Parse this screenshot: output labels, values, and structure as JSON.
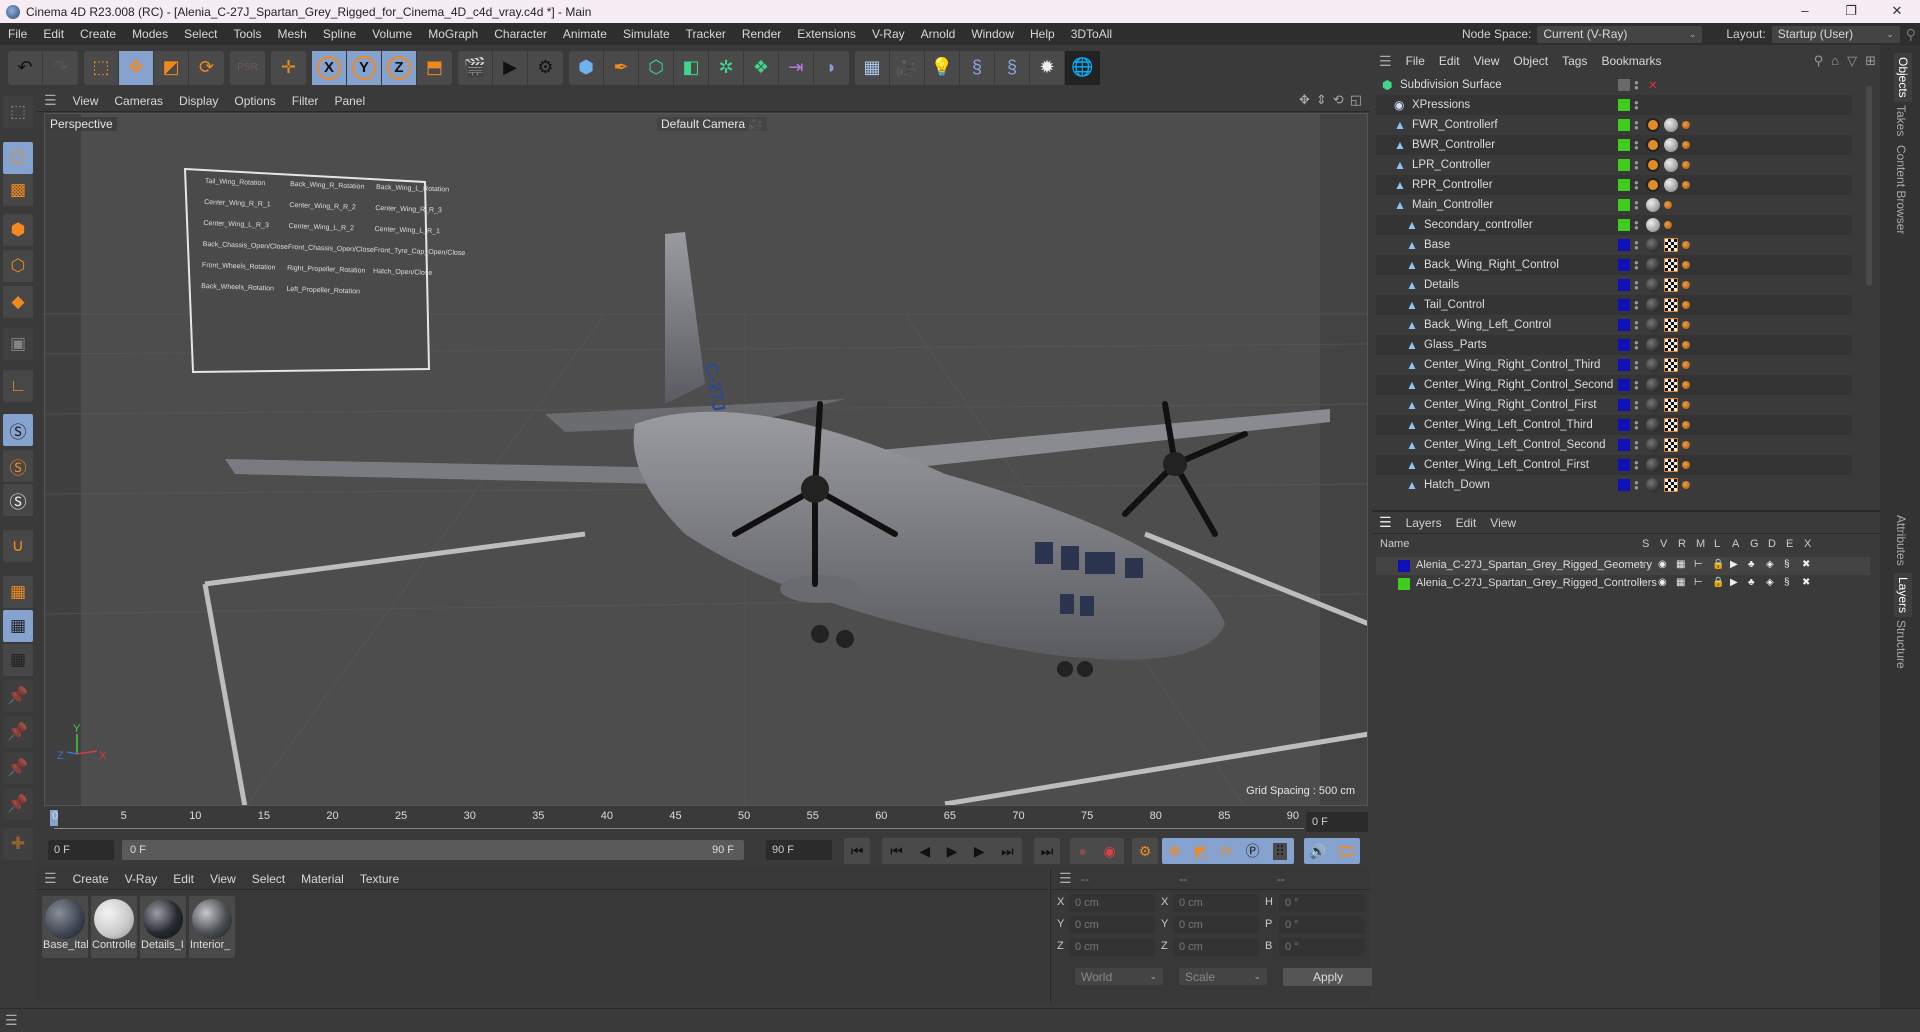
{
  "window": {
    "title": "Cinema 4D R23.008 (RC) - [Alenia_C-27J_Spartan_Grey_Rigged_for_Cinema_4D_c4d_vray.c4d *] - Main",
    "controls": {
      "minimize": "–",
      "maximize": "❐",
      "close": "✕"
    }
  },
  "menubar": {
    "items": [
      "File",
      "Edit",
      "Create",
      "Modes",
      "Select",
      "Tools",
      "Mesh",
      "Spline",
      "Volume",
      "MoGraph",
      "Character",
      "Animate",
      "Simulate",
      "Tracker",
      "Render",
      "Extensions",
      "V-Ray",
      "Arnold",
      "Window",
      "Help",
      "3DToAll"
    ],
    "node_space_label": "Node Space:",
    "node_space_value": "Current (V-Ray)",
    "layout_label": "Layout:",
    "layout_value": "Startup (User)"
  },
  "toolbar": {
    "groups": [
      [
        "undo-icon",
        "redo-icon"
      ],
      [
        "live-selection-icon",
        "move-icon",
        "scale-icon",
        "rotate-icon"
      ],
      [
        "psr-icon"
      ],
      [
        "axis-move-icon"
      ],
      [
        "x-axis-lock-icon",
        "y-axis-lock-icon",
        "z-axis-lock-icon",
        "coordinate-system-icon"
      ],
      [
        "render-view-icon",
        "render-to-picture-viewer-icon",
        "render-settings-icon"
      ],
      [
        "cube-icon",
        "pen-icon",
        "subdivision-icon",
        "extrude-icon",
        "mograph-cloner-icon",
        "array-icon",
        "symmetry-icon",
        "deformer-icon"
      ],
      [
        "floor-icon",
        "camera-icon",
        "light-icon",
        "python-icon",
        "python-generator-icon",
        "xpresso-icon",
        "sphere-wireframe-icon"
      ]
    ]
  },
  "viewport": {
    "menu": [
      "View",
      "Cameras",
      "Display",
      "Options",
      "Filter",
      "Panel"
    ],
    "view_name": "Perspective",
    "camera": "Default Camera",
    "grid_spacing": "Grid Spacing : 500 cm",
    "axis": {
      "x": "X",
      "y": "Y",
      "z": "Z"
    },
    "hud_panel": {
      "labels": [
        "Tail_Wing_Rotation",
        "Back_Wing_R_Rotation",
        "Back_Wing_L_Rotation",
        "Center_Wing_R_R_1",
        "Center_Wing_R_R_2",
        "Center_Wing_R_R_3",
        "Center_Wing_L_R_3",
        "Center_Wing_L_R_2",
        "Center_Wing_L_R_1",
        "Back_Chassis_Open/Close",
        "Front_Chassis_Open/Close",
        "Front_Tyre_Cap_Open/Close",
        "Front_Wheels_Rotation",
        "Right_Propeller_Rotation",
        "Hatch_Open/Close",
        "Back_Wheels_Rotation",
        "Left_Propeller_Rotation"
      ]
    },
    "aircraft_marking": "C-27J"
  },
  "timeline": {
    "ticks": [
      "0",
      "5",
      "10",
      "15",
      "20",
      "25",
      "30",
      "35",
      "40",
      "45",
      "50",
      "55",
      "60",
      "65",
      "70",
      "75",
      "80",
      "85",
      "90"
    ],
    "current_frame": "0 F",
    "start_field": "0 F",
    "range_start": "0 F",
    "range_end": "90 F",
    "end_field": "90 F"
  },
  "material_panel": {
    "menu": [
      "Create",
      "V-Ray",
      "Edit",
      "View",
      "Select",
      "Material",
      "Texture"
    ],
    "materials": [
      {
        "name": "Base_Ital",
        "color": "#3c4350"
      },
      {
        "name": "Controlle",
        "color": "#d6d6d6"
      },
      {
        "name": "Details_I",
        "color": "#262a30"
      },
      {
        "name": "Interior_",
        "color": "#4a4d52"
      }
    ]
  },
  "coord_panel": {
    "header": [
      "--",
      "--",
      "--"
    ],
    "rows": [
      {
        "a_label": "X",
        "a": "0 cm",
        "b_label": "X",
        "b": "0 cm",
        "c_label": "H",
        "c": "0 °"
      },
      {
        "a_label": "Y",
        "a": "0 cm",
        "b_label": "Y",
        "b": "0 cm",
        "c_label": "P",
        "c": "0 °"
      },
      {
        "a_label": "Z",
        "a": "0 cm",
        "b_label": "Z",
        "b": "0 cm",
        "c_label": "B",
        "c": "0 °"
      }
    ],
    "mode_dropdown": "World",
    "type_dropdown": "Scale",
    "apply_label": "Apply"
  },
  "object_manager": {
    "menu": [
      "File",
      "Edit",
      "View",
      "Object",
      "Tags",
      "Bookmarks"
    ],
    "objects": [
      {
        "name": "Subdivision Surface",
        "depth": 0,
        "color": "",
        "icon": "subdivision"
      },
      {
        "name": "XPressions",
        "depth": 1,
        "color": "#3fcc1f",
        "icon": "xpresso"
      },
      {
        "name": "FWR_Controllerf",
        "depth": 1,
        "color": "#3fcc1f",
        "icon": "null"
      },
      {
        "name": "BWR_Controller",
        "depth": 1,
        "color": "#3fcc1f",
        "icon": "null"
      },
      {
        "name": "LPR_Controller",
        "depth": 1,
        "color": "#3fcc1f",
        "icon": "null"
      },
      {
        "name": "RPR_Controller",
        "depth": 1,
        "color": "#3fcc1f",
        "icon": "null"
      },
      {
        "name": "Main_Controller",
        "depth": 1,
        "color": "#3fcc1f",
        "icon": "null"
      },
      {
        "name": "Secondary_controller",
        "depth": 2,
        "color": "#3fcc1f",
        "icon": "null"
      },
      {
        "name": "Base",
        "depth": 2,
        "color": "#1010b8",
        "icon": "null"
      },
      {
        "name": "Back_Wing_Right_Control",
        "depth": 2,
        "color": "#1010b8",
        "icon": "null"
      },
      {
        "name": "Details",
        "depth": 2,
        "color": "#1010b8",
        "icon": "null"
      },
      {
        "name": "Tail_Control",
        "depth": 2,
        "color": "#1010b8",
        "icon": "null"
      },
      {
        "name": "Back_Wing_Left_Control",
        "depth": 2,
        "color": "#1010b8",
        "icon": "null"
      },
      {
        "name": "Glass_Parts",
        "depth": 2,
        "color": "#1010b8",
        "icon": "null"
      },
      {
        "name": "Center_Wing_Right_Control_Third",
        "depth": 2,
        "color": "#1010b8",
        "icon": "null"
      },
      {
        "name": "Center_Wing_Right_Control_Second",
        "depth": 2,
        "color": "#1010b8",
        "icon": "null"
      },
      {
        "name": "Center_Wing_Right_Control_First",
        "depth": 2,
        "color": "#1010b8",
        "icon": "null"
      },
      {
        "name": "Center_Wing_Left_Control_Third",
        "depth": 2,
        "color": "#1010b8",
        "icon": "null"
      },
      {
        "name": "Center_Wing_Left_Control_Second",
        "depth": 2,
        "color": "#1010b8",
        "icon": "null"
      },
      {
        "name": "Center_Wing_Left_Control_First",
        "depth": 2,
        "color": "#1010b8",
        "icon": "null"
      },
      {
        "name": "Hatch_Down",
        "depth": 2,
        "color": "#1010b8",
        "icon": "null"
      }
    ]
  },
  "layer_manager": {
    "menu": [
      "Layers",
      "Edit",
      "View"
    ],
    "columns": [
      "Name",
      "S",
      "V",
      "R",
      "M",
      "L",
      "A",
      "G",
      "D",
      "E",
      "X"
    ],
    "layers": [
      {
        "name": "Alenia_C-27J_Spartan_Grey_Rigged_Geometry",
        "color": "#1010b8"
      },
      {
        "name": "Alenia_C-27J_Spartan_Grey_Rigged_Controllers",
        "color": "#3fcc1f"
      }
    ]
  },
  "side_tabs": {
    "top": [
      "Objects",
      "Takes",
      "Content Browser"
    ],
    "bottom": [
      "Attributes",
      "Layers",
      "Structure"
    ]
  }
}
